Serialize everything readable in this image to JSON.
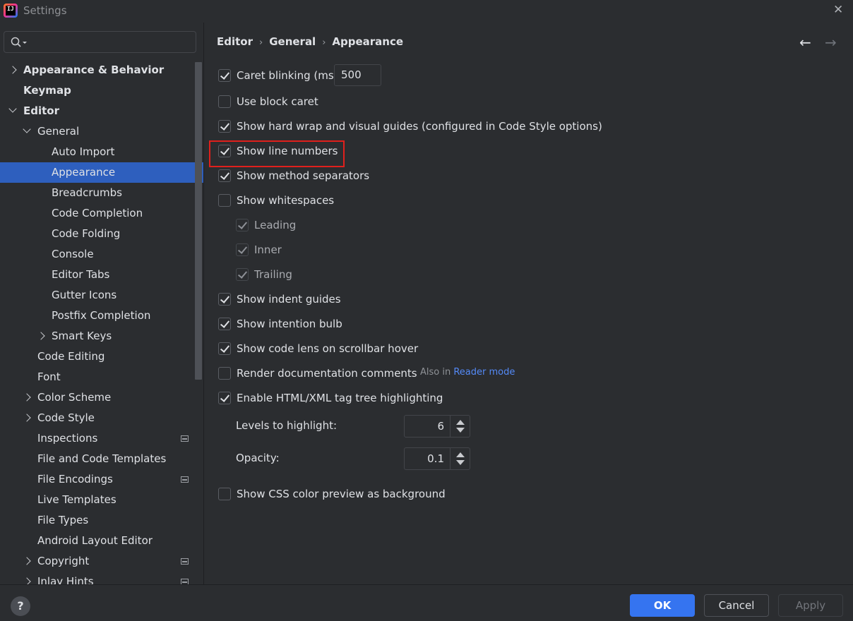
{
  "window": {
    "title": "Settings",
    "app_icon_text": "IJ",
    "close_glyph": "✕"
  },
  "sidebar": {
    "search": {
      "placeholder": "",
      "value": ""
    },
    "items": [
      {
        "label": "Appearance & Behavior",
        "level": 0,
        "expander": "collapsed",
        "bold": true
      },
      {
        "label": "Keymap",
        "level": 0,
        "expander": "none",
        "bold": true
      },
      {
        "label": "Editor",
        "level": 0,
        "expander": "expanded",
        "bold": true
      },
      {
        "label": "General",
        "level": 1,
        "expander": "expanded"
      },
      {
        "label": "Auto Import",
        "level": 2,
        "expander": "none"
      },
      {
        "label": "Appearance",
        "level": 2,
        "expander": "none",
        "selected": true
      },
      {
        "label": "Breadcrumbs",
        "level": 2,
        "expander": "none"
      },
      {
        "label": "Code Completion",
        "level": 2,
        "expander": "none"
      },
      {
        "label": "Code Folding",
        "level": 2,
        "expander": "none"
      },
      {
        "label": "Console",
        "level": 2,
        "expander": "none"
      },
      {
        "label": "Editor Tabs",
        "level": 2,
        "expander": "none"
      },
      {
        "label": "Gutter Icons",
        "level": 2,
        "expander": "none"
      },
      {
        "label": "Postfix Completion",
        "level": 2,
        "expander": "none"
      },
      {
        "label": "Smart Keys",
        "level": 2,
        "expander": "collapsed"
      },
      {
        "label": "Code Editing",
        "level": 1,
        "expander": "none"
      },
      {
        "label": "Font",
        "level": 1,
        "expander": "none"
      },
      {
        "label": "Color Scheme",
        "level": 1,
        "expander": "collapsed"
      },
      {
        "label": "Code Style",
        "level": 1,
        "expander": "collapsed"
      },
      {
        "label": "Inspections",
        "level": 1,
        "expander": "none",
        "project_icon": true
      },
      {
        "label": "File and Code Templates",
        "level": 1,
        "expander": "none"
      },
      {
        "label": "File Encodings",
        "level": 1,
        "expander": "none",
        "project_icon": true
      },
      {
        "label": "Live Templates",
        "level": 1,
        "expander": "none"
      },
      {
        "label": "File Types",
        "level": 1,
        "expander": "none"
      },
      {
        "label": "Android Layout Editor",
        "level": 1,
        "expander": "none"
      },
      {
        "label": "Copyright",
        "level": 1,
        "expander": "collapsed",
        "project_icon": true
      },
      {
        "label": "Inlay Hints",
        "level": 1,
        "expander": "collapsed",
        "project_icon": true
      }
    ]
  },
  "breadcrumb": [
    "Editor",
    "General",
    "Appearance"
  ],
  "breadcrumb_separator": "›",
  "nav": {
    "back": "←",
    "forward": "→"
  },
  "options": {
    "caret_blinking": {
      "label": "Caret blinking (ms):",
      "checked": true,
      "value": "500"
    },
    "block_caret": {
      "label": "Use block caret",
      "checked": false
    },
    "hard_wrap": {
      "label": "Show hard wrap and visual guides (configured in Code Style options)",
      "checked": true
    },
    "line_numbers": {
      "label": "Show line numbers",
      "checked": true
    },
    "method_separators": {
      "label": "Show method separators",
      "checked": true
    },
    "whitespaces": {
      "label": "Show whitespaces",
      "checked": false
    },
    "leading": {
      "label": "Leading",
      "checked": true,
      "disabled": true
    },
    "inner": {
      "label": "Inner",
      "checked": true,
      "disabled": true
    },
    "trailing": {
      "label": "Trailing",
      "checked": true,
      "disabled": true
    },
    "indent_guides": {
      "label": "Show indent guides",
      "checked": true
    },
    "intention_bulb": {
      "label": "Show intention bulb",
      "checked": true
    },
    "code_lens": {
      "label": "Show code lens on scrollbar hover",
      "checked": true
    },
    "render_docs": {
      "label": "Render documentation comments",
      "checked": false,
      "hint_prefix": "Also in",
      "hint_link": "Reader mode"
    },
    "tag_tree": {
      "label": "Enable HTML/XML tag tree highlighting",
      "checked": true
    },
    "levels": {
      "label": "Levels to highlight:",
      "value": "6"
    },
    "opacity": {
      "label": "Opacity:",
      "value": "0.1"
    },
    "css_color": {
      "label": "Show CSS color preview as background",
      "checked": false
    }
  },
  "footer": {
    "help": "?",
    "ok": "OK",
    "cancel": "Cancel",
    "apply": "Apply"
  },
  "colors": {
    "background": "#2b2d30",
    "selection": "#2e5fbe",
    "primary_button": "#3574f0",
    "link": "#548af7",
    "annotation_box": "#e0201c"
  }
}
